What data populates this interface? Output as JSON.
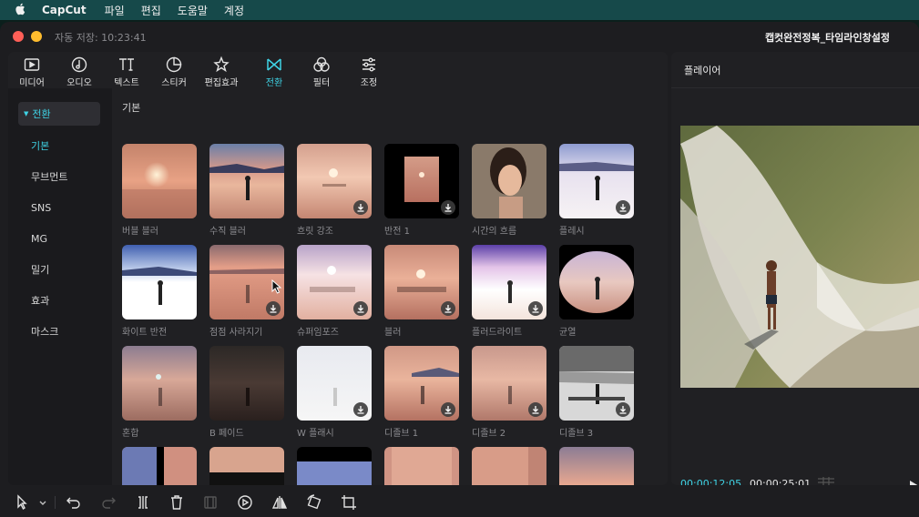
{
  "menubar": {
    "app_name": "CapCut",
    "items": [
      "파일",
      "편집",
      "도움말",
      "계정"
    ]
  },
  "window": {
    "autosave": "자동 저장: 10:23:41",
    "project_title": "캡컷완전정복_타임라인창설정"
  },
  "toolbar": {
    "items": [
      {
        "label": "미디어",
        "icon": "media-icon"
      },
      {
        "label": "오디오",
        "icon": "audio-icon"
      },
      {
        "label": "텍스트",
        "icon": "text-icon"
      },
      {
        "label": "스티커",
        "icon": "sticker-icon"
      },
      {
        "label": "편집효과",
        "icon": "effects-icon"
      },
      {
        "label": "전환",
        "icon": "transition-icon"
      },
      {
        "label": "필터",
        "icon": "filter-icon"
      },
      {
        "label": "조정",
        "icon": "adjust-icon"
      }
    ],
    "active": "전환"
  },
  "sidebar": {
    "parent": "전환",
    "items": [
      "기본",
      "무브먼트",
      "SNS",
      "MG",
      "밀기",
      "효과",
      "마스크"
    ],
    "selected": "기본"
  },
  "grid": {
    "section_label": "기본",
    "rows": [
      [
        "버블 블러",
        "수직 블러",
        "흐릿 강조",
        "반전 1",
        "시간의 흐름",
        "플레시"
      ],
      [
        "화이트 반전",
        "점점 사라지기",
        "슈퍼임포즈",
        "블러",
        "플러드라이트",
        "균열"
      ],
      [
        "혼합",
        "B 페이드",
        "W 플래시",
        "디졸브 1",
        "디졸브 2",
        "디졸브 3"
      ]
    ]
  },
  "player": {
    "title": "플레이어",
    "current_time": "00:00:12:05",
    "total_time": "00:00:25:01"
  },
  "colors": {
    "accent": "#3fd3e5",
    "menubar_bg": "#16494a",
    "panel_bg": "#202023"
  }
}
